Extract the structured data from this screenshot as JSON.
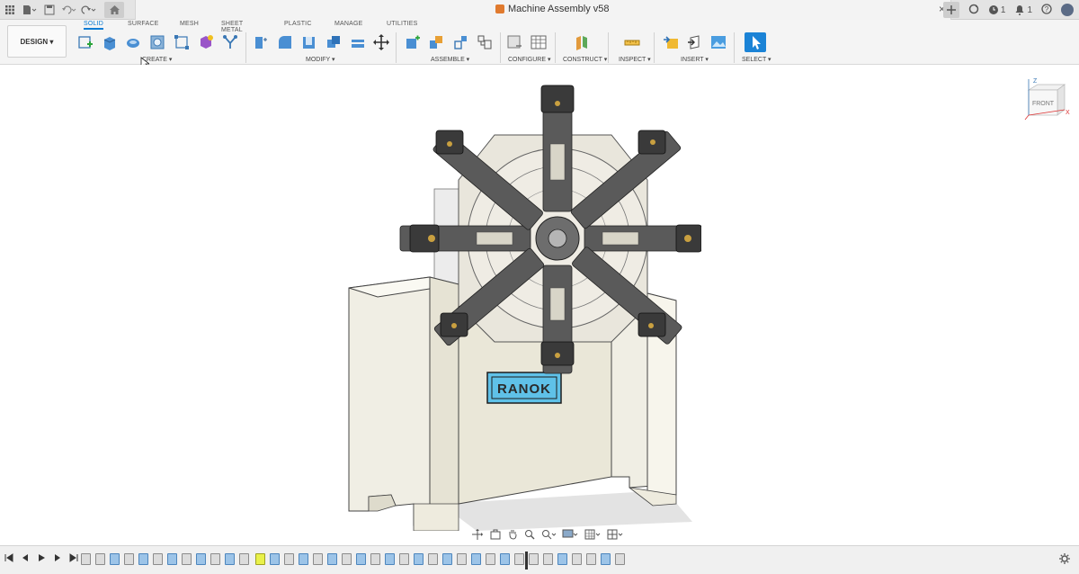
{
  "app": {
    "title": "Machine Assembly v58",
    "close_glyph": "×",
    "counter_a": "1",
    "counter_b": "1"
  },
  "workspace": {
    "design_label": "DESIGN ▾"
  },
  "tabs": [
    "SOLID",
    "SURFACE",
    "MESH",
    "SHEET METAL",
    "PLASTIC",
    "MANAGE",
    "UTILITIES"
  ],
  "active_tab": "SOLID",
  "groups": {
    "create": "CREATE ▾",
    "modify": "MODIFY ▾",
    "assemble": "ASSEMBLE ▾",
    "configure": "CONFIGURE ▾",
    "construct": "CONSTRUCT ▾",
    "inspect": "INSPECT ▾",
    "insert": "INSERT ▾",
    "select": "SELECT ▾"
  },
  "viewcube": {
    "face": "FRONT",
    "axis_z": "Z",
    "axis_x": "X"
  },
  "model": {
    "brand_plate": "RANOK"
  },
  "colors": {
    "accent": "#0a7bd4",
    "brand_plate": "#5fc1e8",
    "base_body": "#eeece2"
  },
  "icons": [
    "grid-icon",
    "file-icon",
    "save-icon",
    "undo-icon",
    "redo-icon",
    "home-icon",
    "plus-icon",
    "refresh-icon",
    "clock-icon",
    "bell-icon",
    "help-icon",
    "user-icon",
    "gear-icon"
  ]
}
